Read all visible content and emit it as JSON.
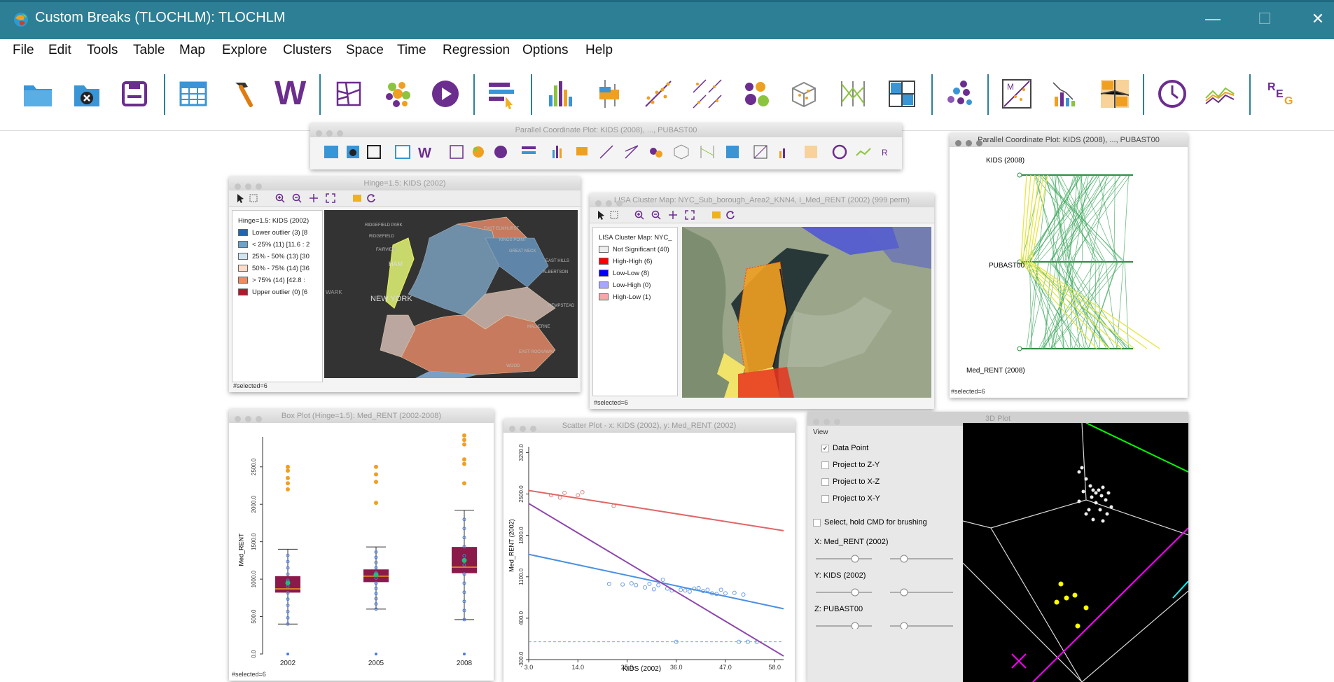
{
  "window": {
    "title": "Custom Breaks (TLOCHLM): TLOCHLM",
    "minimize": "—",
    "maximize": "☐",
    "close": "✕"
  },
  "menu": [
    "File",
    "Edit",
    "Tools",
    "Table",
    "Map",
    "Explore",
    "Clusters",
    "Space",
    "Time",
    "Regression",
    "Options",
    "Help"
  ],
  "toolbar": {
    "reg_label_r": "R",
    "reg_label_e": "E",
    "reg_label_g": "G",
    "weights_label": "W"
  },
  "colors": {
    "titlebar": "#2c7f95",
    "accent_purple": "#6b2d8e",
    "accent_blue": "#2a8fd6"
  },
  "pcp_toolbar_win": {
    "title": "Parallel Coordinate Plot: KIDS (2008), ..., PUBAST00"
  },
  "hinge_map": {
    "title": "Hinge=1.5: KIDS (2002)",
    "legend_title": "Hinge=1.5: KIDS (2002)",
    "legend": [
      {
        "label": "Lower outlier (3)  [8",
        "color": "#2166ac"
      },
      {
        "label": "< 25% (11)  [11.6 : 2",
        "color": "#6aa3cc"
      },
      {
        "label": "25% - 50% (13)  [30",
        "color": "#d1e5f0"
      },
      {
        "label": "50% - 75% (14)  [36",
        "color": "#fddbc7"
      },
      {
        "label": "> 75% (14)  [42.8 :",
        "color": "#ef8a62"
      },
      {
        "label": "Upper outlier (0)  [6",
        "color": "#b2182b"
      }
    ],
    "status": "#selected=6",
    "place_labels": [
      "RIDGEFIELD PARK",
      "RIDGEFIELD",
      "FAIRVIEW",
      "HAM",
      "NEW YORK",
      "EAST ELMHURST",
      "KINGS POINT",
      "GREAT NECK",
      "EAST HILLS",
      "ALBERTSON",
      "HEMPSTEAD",
      "MALVERNE",
      "EAST ROCKAWAY",
      "WOOD",
      "WARK"
    ]
  },
  "lisa_map": {
    "title": "LISA Cluster Map: NYC_Sub_borough_Area2_KNN4, I_Med_RENT (2002) (999 perm)",
    "legend_title": "LISA Cluster Map: NYC_",
    "legend": [
      {
        "label": "Not Significant (40)",
        "color": "#eeeeee"
      },
      {
        "label": "High-High (6)",
        "color": "#ff0000"
      },
      {
        "label": "Low-Low (8)",
        "color": "#0000ff"
      },
      {
        "label": "Low-High (0)",
        "color": "#a7a6ff"
      },
      {
        "label": "High-Low (1)",
        "color": "#f4a8a8"
      }
    ],
    "status": "#selected=6"
  },
  "pcp_right": {
    "title": "Parallel Coordinate Plot: KIDS (2008), ..., PUBAST00",
    "axes": [
      "KIDS (2008)",
      "PUBAST00",
      "Med_RENT (2008)"
    ],
    "status": "#selected=6"
  },
  "box_plot": {
    "title": "Box Plot (Hinge=1.5): Med_RENT (2002-2008)",
    "ylabel": "Med_RENT",
    "yticks": [
      "0.0",
      "500.0",
      "1000.0",
      "1500.0",
      "2000.0",
      "2500.0"
    ],
    "categories": [
      "2002",
      "2005",
      "2008"
    ],
    "status": "#selected=6"
  },
  "scatter": {
    "title": "Scatter Plot - x: KIDS (2002), y: Med_RENT (2002)",
    "xlabel": "KIDS (2002)",
    "ylabel": "Med_RENT (2002)",
    "xticks": [
      "3.0",
      "14.0",
      "25.0",
      "36.0",
      "47.0",
      "58.0"
    ],
    "yticks": [
      "-300.0",
      "400.0",
      "1100.0",
      "1800.0",
      "2500.0",
      "3200.0"
    ]
  },
  "plot3d": {
    "title": "3D Plot",
    "view_label": "View",
    "options": [
      {
        "label": "Data Point",
        "checked": "✓"
      },
      {
        "label": "Project to Z-Y",
        "checked": ""
      },
      {
        "label": "Project to X-Z",
        "checked": ""
      },
      {
        "label": "Project to X-Y",
        "checked": ""
      }
    ],
    "brush_label": "Select, hold CMD for brushing",
    "x_label": "X: Med_RENT (2002)",
    "y_label": "Y: KIDS (2002)",
    "z_label": "Z: PUBAST00"
  },
  "chart_data": [
    {
      "type": "box",
      "title": "Box Plot (Hinge=1.5): Med_RENT (2002-2008)",
      "ylabel": "Med_RENT",
      "categories": [
        "2002",
        "2005",
        "2008"
      ],
      "ylim": [
        0,
        2900
      ],
      "boxes": [
        {
          "category": "2002",
          "min": 400,
          "q1": 820,
          "median": 870,
          "q3": 1040,
          "max": 1400,
          "mean": 950,
          "outliers": [
            2200,
            2280,
            2350,
            2450,
            2500
          ]
        },
        {
          "category": "2005",
          "min": 600,
          "q1": 960,
          "median": 1040,
          "q3": 1130,
          "max": 1430,
          "mean": 1060,
          "outliers": [
            2020,
            2300,
            2400,
            2500
          ]
        },
        {
          "category": "2008",
          "min": 460,
          "q1": 1080,
          "median": 1160,
          "q3": 1430,
          "max": 1920,
          "mean": 1250,
          "outliers": [
            2280,
            2540,
            2600,
            2800,
            2860,
            2920
          ]
        }
      ]
    },
    {
      "type": "scatter",
      "title": "Scatter Plot - x: KIDS (2002), y: Med_RENT (2002)",
      "xlabel": "KIDS (2002)",
      "ylabel": "Med_RENT (2002)",
      "xlim": [
        3,
        60
      ],
      "ylim": [
        -300,
        3300
      ],
      "points_selected": [
        [
          8,
          2480
        ],
        [
          10,
          2440
        ],
        [
          11,
          2520
        ],
        [
          14,
          2480
        ],
        [
          15,
          2530
        ],
        [
          22,
          2300
        ]
      ],
      "points_unselected": [
        [
          21,
          980
        ],
        [
          24,
          970
        ],
        [
          26,
          990
        ],
        [
          27,
          960
        ],
        [
          29,
          920
        ],
        [
          30,
          980
        ],
        [
          31,
          890
        ],
        [
          32,
          960
        ],
        [
          33,
          1050
        ],
        [
          34,
          900
        ],
        [
          35,
          870
        ],
        [
          37,
          880
        ],
        [
          38,
          870
        ],
        [
          39,
          850
        ],
        [
          40,
          900
        ],
        [
          41,
          910
        ],
        [
          42,
          860
        ],
        [
          43,
          880
        ],
        [
          44,
          820
        ],
        [
          45,
          810
        ],
        [
          46,
          880
        ],
        [
          47,
          820
        ],
        [
          49,
          830
        ],
        [
          51,
          800
        ],
        [
          36,
          0
        ],
        [
          50,
          0
        ],
        [
          52,
          0
        ],
        [
          54,
          0
        ]
      ],
      "lines": [
        {
          "name": "selected",
          "color": "#e06666",
          "y_at_xmin": 2560,
          "y_at_xmax": 1880
        },
        {
          "name": "unselected",
          "color": "#4a90e2",
          "y_at_xmin": 1480,
          "y_at_xmax": 560
        },
        {
          "name": "all",
          "color": "#8e44ad",
          "y_at_xmin": 2340,
          "y_at_xmax": -240
        }
      ]
    }
  ]
}
